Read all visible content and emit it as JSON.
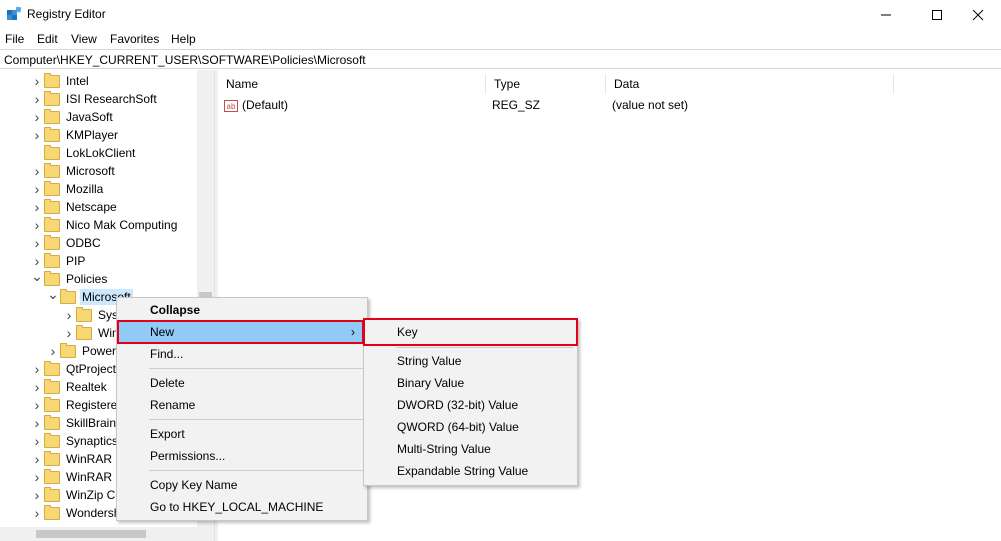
{
  "window": {
    "title": "Registry Editor",
    "minimize_glyph": "—",
    "maximize_glyph": "☐",
    "close_glyph": "✕"
  },
  "menu": [
    "File",
    "Edit",
    "View",
    "Favorites",
    "Help"
  ],
  "address": "Computer\\HKEY_CURRENT_USER\\SOFTWARE\\Policies\\Microsoft",
  "tree": {
    "items": [
      {
        "label": "Intel",
        "level": 0,
        "expander": "collapsed"
      },
      {
        "label": "ISI ResearchSoft",
        "level": 0,
        "expander": "collapsed"
      },
      {
        "label": "JavaSoft",
        "level": 0,
        "expander": "collapsed"
      },
      {
        "label": "KMPlayer",
        "level": 0,
        "expander": "collapsed"
      },
      {
        "label": "LokLokClient",
        "level": 0,
        "expander": "none"
      },
      {
        "label": "Microsoft",
        "level": 0,
        "expander": "collapsed"
      },
      {
        "label": "Mozilla",
        "level": 0,
        "expander": "collapsed"
      },
      {
        "label": "Netscape",
        "level": 0,
        "expander": "collapsed"
      },
      {
        "label": "Nico Mak Computing",
        "level": 0,
        "expander": "collapsed"
      },
      {
        "label": "ODBC",
        "level": 0,
        "expander": "collapsed"
      },
      {
        "label": "PIP",
        "level": 0,
        "expander": "collapsed"
      },
      {
        "label": "Policies",
        "level": 0,
        "expander": "expanded"
      },
      {
        "label": "Microsoft",
        "level": 1,
        "expander": "expanded",
        "selected": true
      },
      {
        "label": "Syst",
        "level": 2,
        "expander": "collapsed"
      },
      {
        "label": "Win",
        "level": 2,
        "expander": "collapsed"
      },
      {
        "label": "Power",
        "level": 1,
        "expander": "collapsed"
      },
      {
        "label": "QtProject",
        "level": 0,
        "expander": "collapsed"
      },
      {
        "label": "Realtek",
        "level": 0,
        "expander": "collapsed"
      },
      {
        "label": "Registered",
        "level": 0,
        "expander": "collapsed"
      },
      {
        "label": "SkillBrains",
        "level": 0,
        "expander": "collapsed"
      },
      {
        "label": "Synaptics",
        "level": 0,
        "expander": "collapsed"
      },
      {
        "label": "WinRAR",
        "level": 0,
        "expander": "collapsed"
      },
      {
        "label": "WinRAR S",
        "level": 0,
        "expander": "collapsed"
      },
      {
        "label": "WinZip Co",
        "level": 0,
        "expander": "collapsed"
      },
      {
        "label": "Wondersh",
        "level": 0,
        "expander": "collapsed"
      }
    ]
  },
  "list": {
    "columns": [
      "Name",
      "Type",
      "Data"
    ],
    "rows": [
      {
        "name": "(Default)",
        "type": "REG_SZ",
        "data": "(value not set)",
        "icon_text": "ab"
      }
    ]
  },
  "context_menu": {
    "items": [
      "Collapse",
      "New",
      "Find...",
      "Delete",
      "Rename",
      "Export",
      "Permissions...",
      "Copy Key Name",
      "Go to HKEY_LOCAL_MACHINE"
    ],
    "submenu_arrow": "›"
  },
  "submenu": {
    "items": [
      "Key",
      "String Value",
      "Binary Value",
      "DWORD (32-bit) Value",
      "QWORD (64-bit) Value",
      "Multi-String Value",
      "Expandable String Value"
    ]
  },
  "colors": {
    "highlight": "#91c9f7",
    "annotation": "#e3001b",
    "folder": "#f8d775"
  }
}
